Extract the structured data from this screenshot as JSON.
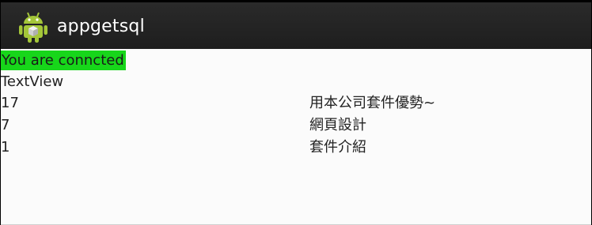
{
  "app": {
    "title": "appgetsql",
    "icon": "android-robot-icon",
    "accent": "#a4c639"
  },
  "status": {
    "text": "You are conncted",
    "color": "#17d61a"
  },
  "placeholder_text": "TextView",
  "records": [
    {
      "id": "17",
      "name": "用本公司套件優勢~"
    },
    {
      "id": "7",
      "name": "網頁設計"
    },
    {
      "id": "1",
      "name": "套件介紹"
    }
  ]
}
